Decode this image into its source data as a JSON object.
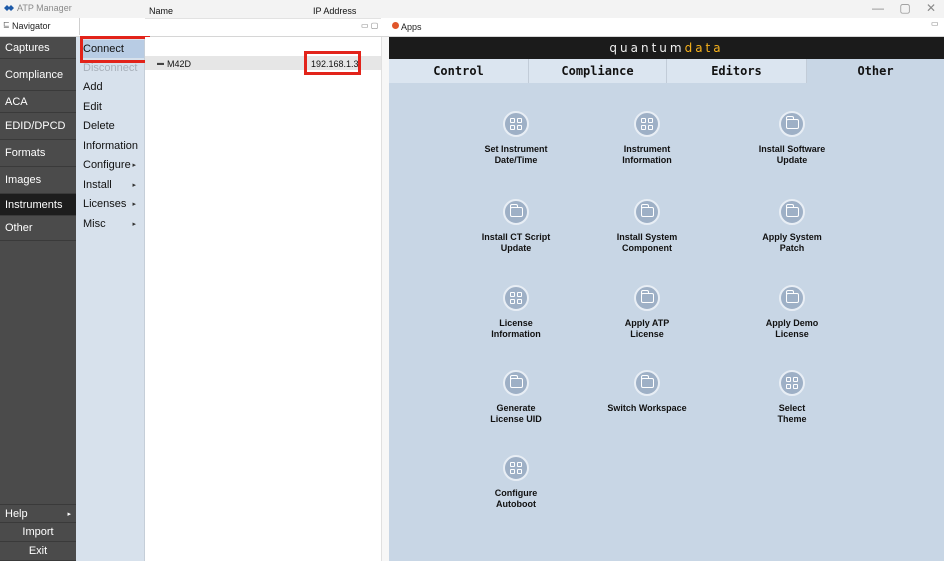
{
  "window": {
    "title": "ATP Manager",
    "min": "—",
    "restore": "▢",
    "close": "✕"
  },
  "view_tabs": {
    "navigator": "Navigator",
    "apps": "Apps",
    "nav_minmax": "▭ ▢",
    "apps_minmax": "▭"
  },
  "sidebar": {
    "items": [
      {
        "label": "Captures"
      },
      {
        "label": "Compliance"
      },
      {
        "label": "ACA"
      },
      {
        "label": "EDID/DPCD"
      },
      {
        "label": "Formats"
      },
      {
        "label": "Images"
      },
      {
        "label": "Instruments"
      },
      {
        "label": "Other"
      }
    ],
    "bottom": [
      {
        "label": "Help",
        "arrow": "▸"
      },
      {
        "label": "Import"
      },
      {
        "label": "Exit"
      }
    ]
  },
  "menu": {
    "items": [
      {
        "label": "Connect"
      },
      {
        "label": "Disconnect"
      },
      {
        "label": "Add"
      },
      {
        "label": "Edit"
      },
      {
        "label": "Delete"
      },
      {
        "label": "Information"
      },
      {
        "label": "Configure",
        "arrow": "▸"
      },
      {
        "label": "Install",
        "arrow": "▸"
      },
      {
        "label": "Licenses",
        "arrow": "▸"
      },
      {
        "label": "Misc",
        "arrow": "▸"
      }
    ]
  },
  "table": {
    "headers": [
      "Name",
      "IP Address"
    ],
    "rows": [
      {
        "name": "M42D",
        "ip": "192.168.1.3"
      }
    ]
  },
  "apps": {
    "brand_left": "quantum",
    "brand_right": "data",
    "tabs": [
      "Control",
      "Compliance",
      "Editors",
      "Other"
    ],
    "active_tab": "Other",
    "items": [
      {
        "label": "Set Instrument\nDate/Time",
        "icon": "grid-icon"
      },
      {
        "label": "Instrument\nInformation",
        "icon": "grid-icon"
      },
      {
        "label": "Install Software\nUpdate",
        "icon": "folder-icon"
      },
      {
        "label": "Install CT Script\nUpdate",
        "icon": "folder-icon"
      },
      {
        "label": "Install System\nComponent",
        "icon": "folder-icon"
      },
      {
        "label": "Apply System\nPatch",
        "icon": "folder-icon"
      },
      {
        "label": "License\nInformation",
        "icon": "grid-icon"
      },
      {
        "label": "Apply ATP\nLicense",
        "icon": "folder-icon"
      },
      {
        "label": "Apply Demo\nLicense",
        "icon": "folder-icon"
      },
      {
        "label": "Generate\nLicense UID",
        "icon": "folder-icon"
      },
      {
        "label": "Switch Workspace",
        "icon": "folder-icon"
      },
      {
        "label": "Select\nTheme",
        "icon": "grid-icon"
      },
      {
        "label": "Configure\nAutoboot",
        "icon": "grid-icon"
      }
    ]
  },
  "colors": {
    "accent_red": "#e2231a",
    "brand_orange": "#f7b21c",
    "apps_bg": "#c8d6e5"
  }
}
